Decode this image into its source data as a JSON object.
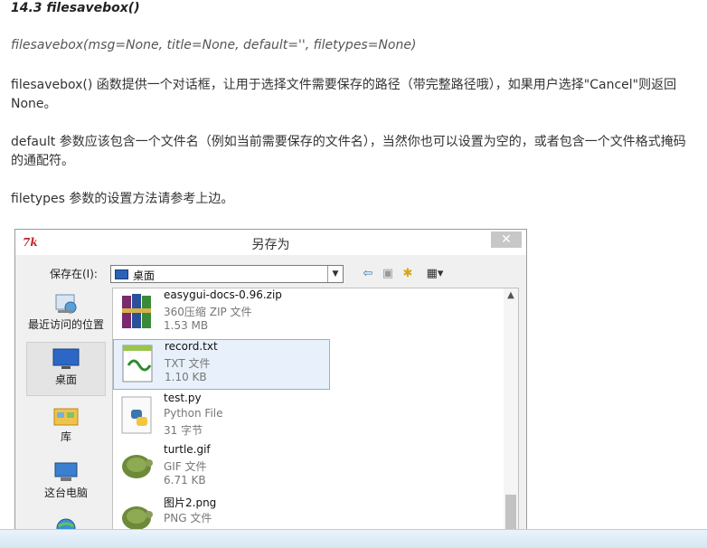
{
  "doc": {
    "heading": "14.3 filesavebox()",
    "signature": "filesavebox(msg=None, title=None, default='', filetypes=None)",
    "para1": "filesavebox() 函数提供一个对话框，让用于选择文件需要保存的路径（带完整路径哦），如果用户选择\"Cancel\"则返回None。",
    "para2": "default 参数应该包含一个文件名（例如当前需要保存的文件名），当然你也可以设置为空的，或者包含一个文件格式掩码的通配符。",
    "para3": "filetypes 参数的设置方法请参考上边。"
  },
  "dialog": {
    "app_icon": "7k",
    "title": "另存为",
    "close": "✕",
    "save_in_label": "保存在(I):",
    "location": "桌面",
    "places": [
      {
        "label": "最近访问的位置",
        "icon": "recent-icon"
      },
      {
        "label": "桌面",
        "icon": "desktop-icon"
      },
      {
        "label": "库",
        "icon": "library-icon"
      },
      {
        "label": "这台电脑",
        "icon": "computer-icon"
      }
    ],
    "files": [
      {
        "name": "easygui-docs-0.96.zip",
        "type": "360压缩 ZIP 文件",
        "size": "1.53 MB",
        "icon": "zip-icon"
      },
      {
        "name": "record.txt",
        "type": "TXT 文件",
        "size": "1.10 KB",
        "icon": "txt-icon"
      },
      {
        "name": "test.py",
        "type": "Python File",
        "size": "31 字节",
        "icon": "python-icon"
      },
      {
        "name": "turtle.gif",
        "type": "GIF 文件",
        "size": "6.71 KB",
        "icon": "gif-icon"
      },
      {
        "name": "图片2.png",
        "type": "PNG 文件",
        "size": "",
        "icon": "png-icon"
      }
    ]
  }
}
